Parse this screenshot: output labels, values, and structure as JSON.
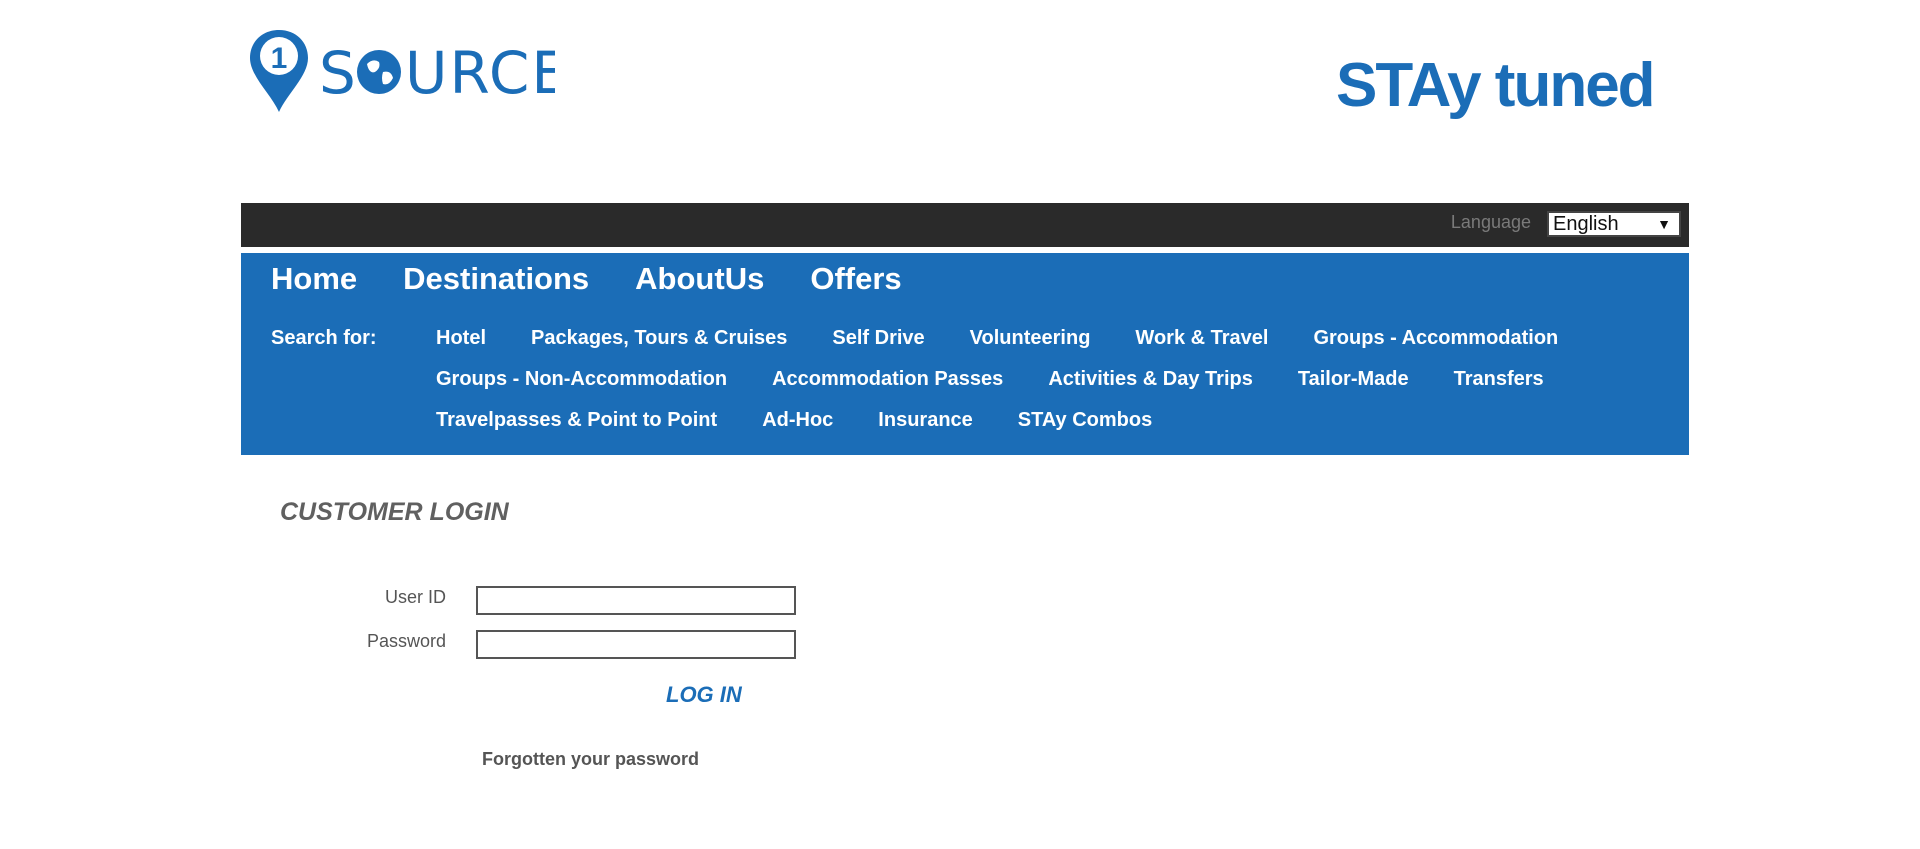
{
  "brand": {
    "left_logo_text": "SOURCE",
    "left_logo_number": "1",
    "right_logo_text": "STAy tuned",
    "color": "#1b6db7"
  },
  "topbar": {
    "language_label": "Language",
    "language_value": "English"
  },
  "nav": {
    "main": [
      "Home",
      "Destinations",
      "AboutUs",
      "Offers"
    ],
    "search_label": "Search for:",
    "search_rows": [
      [
        "Hotel",
        "Packages, Tours & Cruises",
        "Self Drive",
        "Volunteering",
        "Work & Travel",
        "Groups - Accommodation"
      ],
      [
        "Groups - Non-Accommodation",
        "Accommodation Passes",
        "Activities & Day Trips",
        "Tailor-Made",
        "Transfers"
      ],
      [
        "Travelpasses & Point to Point",
        "Ad-Hoc",
        "Insurance",
        "STAy Combos"
      ]
    ]
  },
  "login": {
    "title": "CUSTOMER LOGIN",
    "user_id_label": "User ID",
    "password_label": "Password",
    "user_id_value": "",
    "password_value": "",
    "button": "LOG IN",
    "forgot": "Forgotten your password"
  }
}
